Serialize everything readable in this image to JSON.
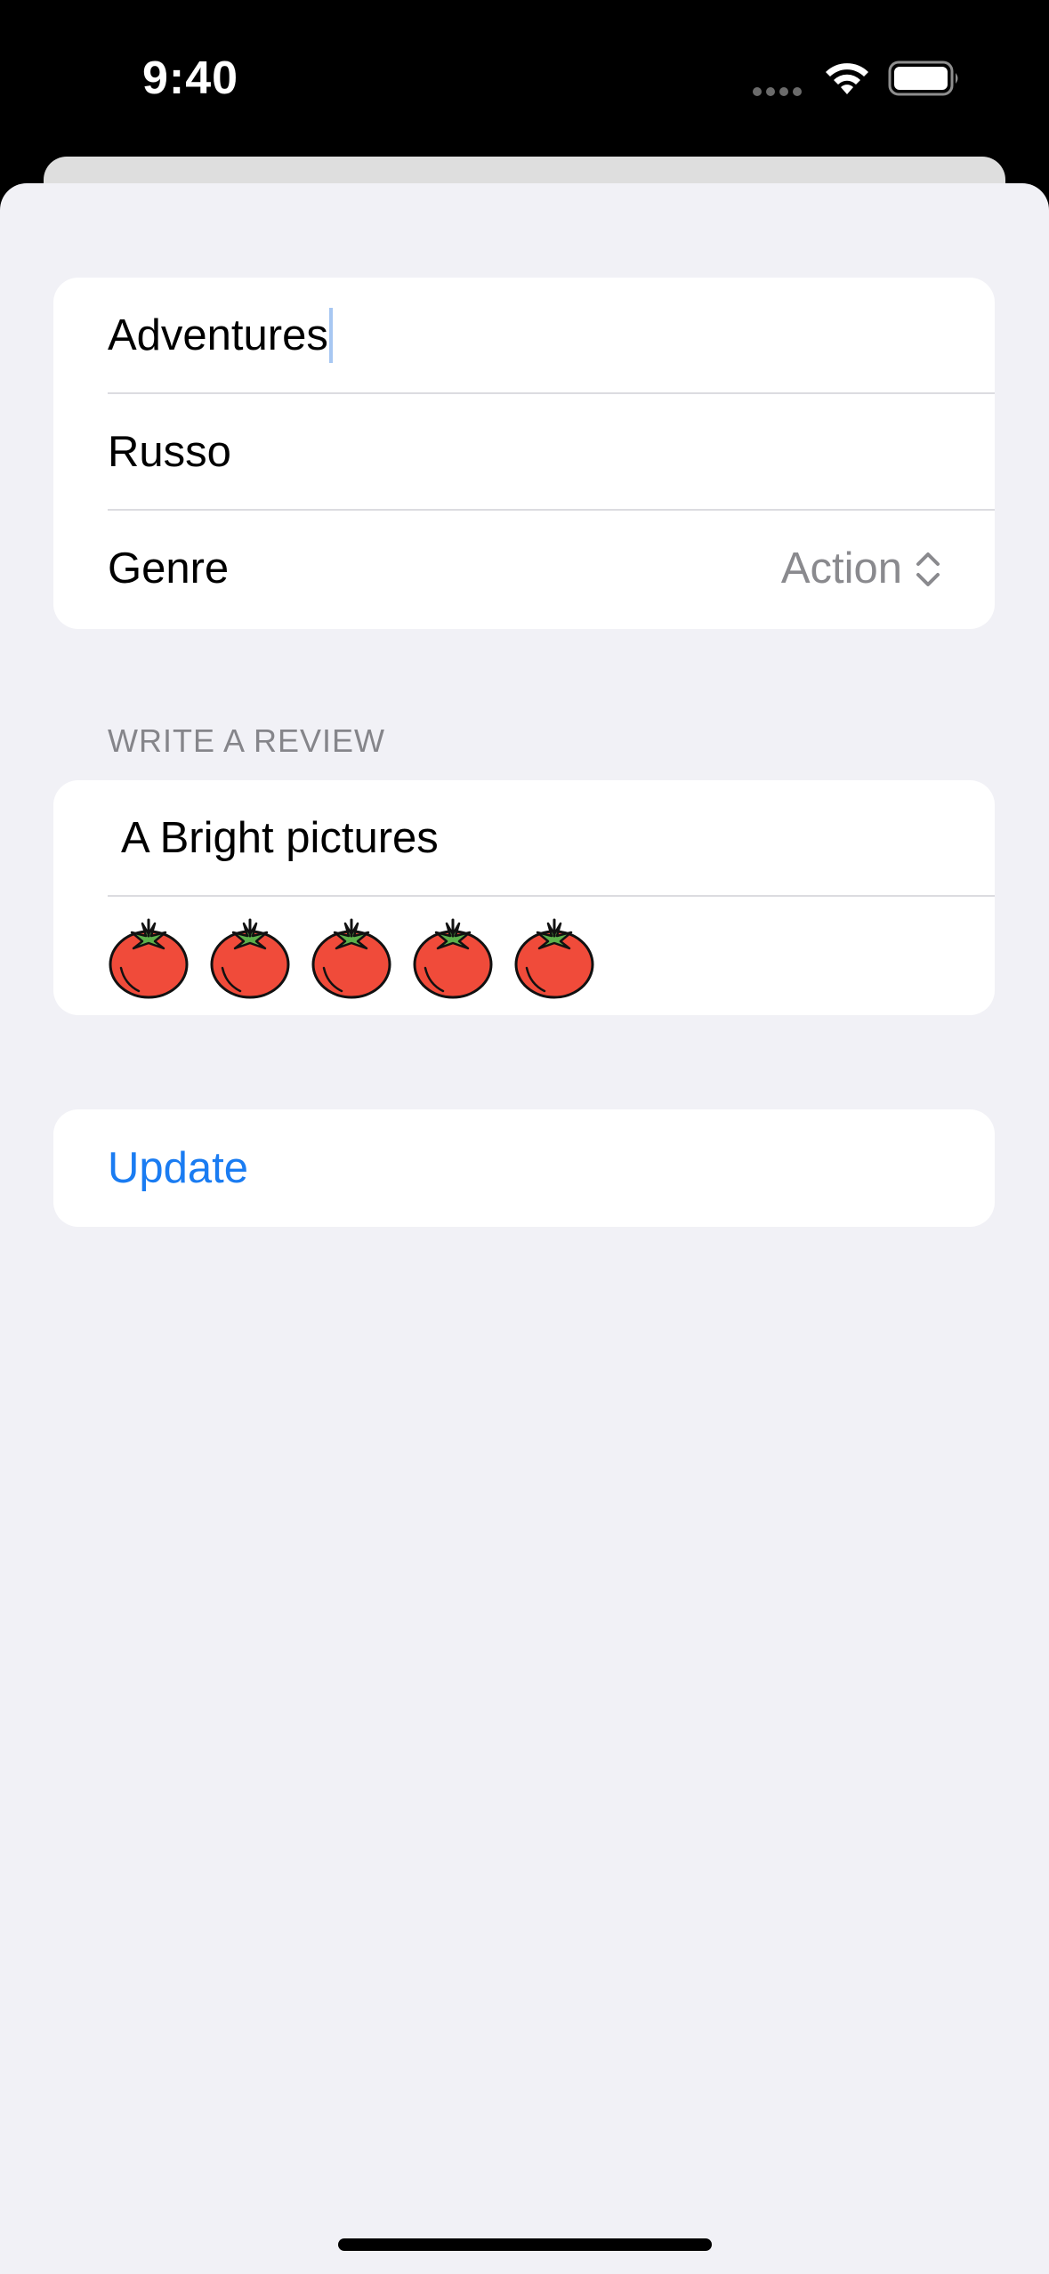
{
  "status_bar": {
    "time": "9:40"
  },
  "form": {
    "title_field": {
      "value": "Adventures"
    },
    "director_field": {
      "value": "Russo"
    },
    "genre": {
      "label": "Genre",
      "value": "Action"
    }
  },
  "review_section": {
    "header": "WRITE A REVIEW",
    "review_field": {
      "value": "A Bright pictures"
    },
    "rating": {
      "value": 5,
      "max": 5,
      "icon": "tomato-icon"
    }
  },
  "actions": {
    "update_label": "Update"
  },
  "colors": {
    "accent": "#1a7cf2",
    "background": "#f1f1f6",
    "card": "#ffffff",
    "secondary_text": "#8a8a8e",
    "tomato": "#f04b3a",
    "tomato_leaf": "#5cb04a"
  }
}
